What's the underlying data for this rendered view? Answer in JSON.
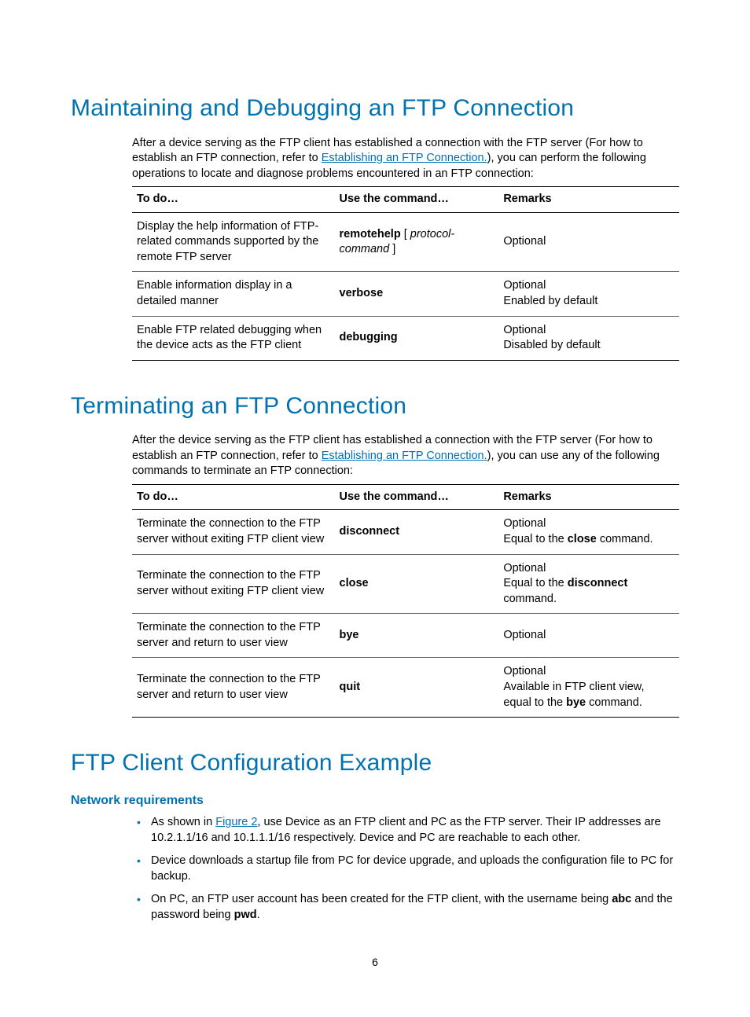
{
  "section1": {
    "heading": "Maintaining and Debugging an FTP Connection",
    "intro_prefix": "After a device serving as the FTP client has established a connection with the FTP server (For how to establish an FTP connection, refer to ",
    "intro_link": "Establishing an FTP Connection.",
    "intro_suffix": "), you can perform the following operations to locate and diagnose problems encountered in an FTP connection:",
    "headers": {
      "todo": "To do…",
      "cmd": "Use the command…",
      "rem": "Remarks"
    },
    "rows": [
      {
        "todo": "Display the help information of FTP-related commands supported by the remote FTP server",
        "cmd_bold": "remotehelp",
        "cmd_bracket_open": " [ ",
        "cmd_ital": "protocol-command",
        "cmd_bracket_close": " ]",
        "rem_line1": "Optional",
        "rem_line2": ""
      },
      {
        "todo": "Enable information display in a detailed manner",
        "cmd_bold": "verbose",
        "rem_line1": "Optional",
        "rem_line2": "Enabled by default"
      },
      {
        "todo": "Enable FTP related debugging when the device acts as the FTP client",
        "cmd_bold": "debugging",
        "rem_line1": "Optional",
        "rem_line2": "Disabled by default"
      }
    ]
  },
  "section2": {
    "heading": "Terminating an FTP Connection",
    "intro_prefix": "After the device serving as the FTP client has established a connection with the FTP server (For how to establish an FTP connection, refer to ",
    "intro_link": "Establishing an FTP Connection.",
    "intro_suffix": "), you can use any of the following commands to terminate an FTP connection:",
    "headers": {
      "todo": "To do…",
      "cmd": "Use the command…",
      "rem": "Remarks"
    },
    "rows": [
      {
        "todo": "Terminate the connection to the FTP server without exiting FTP client view",
        "cmd_bold": "disconnect",
        "rem_line1": "Optional",
        "rem_pre": "Equal to the ",
        "rem_bold": "close",
        "rem_post": " command."
      },
      {
        "todo": "Terminate the connection to the FTP server without exiting FTP client view",
        "cmd_bold": "close",
        "rem_line1": "Optional",
        "rem_pre": "Equal to the ",
        "rem_bold": "disconnect",
        "rem_post": " command."
      },
      {
        "todo": "Terminate the connection to the FTP server and return to user view",
        "cmd_bold": "bye",
        "rem_line1": "Optional",
        "rem_pre": "",
        "rem_bold": "",
        "rem_post": ""
      },
      {
        "todo": "Terminate the connection to the FTP server and return to user view",
        "cmd_bold": "quit",
        "rem_line1": "Optional",
        "rem_pre": "Available in FTP client view, equal to the ",
        "rem_bold": "bye",
        "rem_post": " command."
      }
    ]
  },
  "section3": {
    "heading": "FTP Client Configuration Example",
    "subheading": "Network requirements",
    "bullet1_pre": "As shown in ",
    "bullet1_link": "Figure 2",
    "bullet1_post": ", use Device as an FTP client and PC as the FTP server. Their IP addresses are 10.2.1.1/16 and 10.1.1.1/16 respectively. Device and PC are reachable to each other.",
    "bullet2": "Device downloads a startup file from PC for device upgrade, and uploads the configuration file to PC for backup.",
    "bullet3_pre": "On PC, an FTP user account has been created for the FTP client, with the username being ",
    "bullet3_bold1": "abc",
    "bullet3_mid": " and the password being ",
    "bullet3_bold2": "pwd",
    "bullet3_post": "."
  },
  "page_number": "6"
}
